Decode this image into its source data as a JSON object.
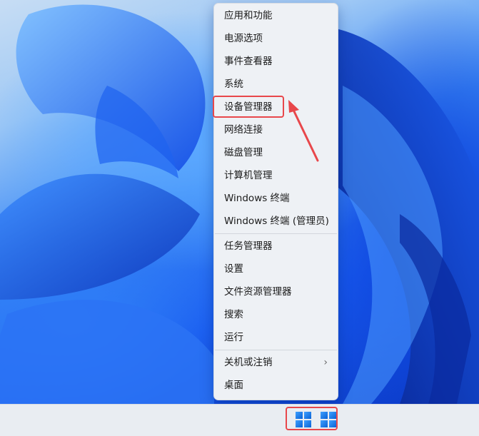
{
  "context_menu": {
    "items": [
      {
        "label": "应用和功能"
      },
      {
        "label": "电源选项"
      },
      {
        "label": "事件查看器"
      },
      {
        "label": "系统"
      },
      {
        "label": "设备管理器"
      },
      {
        "label": "网络连接"
      },
      {
        "label": "磁盘管理"
      },
      {
        "label": "计算机管理"
      },
      {
        "label": "Windows 终端"
      },
      {
        "label": "Windows 终端 (管理员)"
      },
      {
        "label": "任务管理器"
      },
      {
        "label": "设置"
      },
      {
        "label": "文件资源管理器"
      },
      {
        "label": "搜索"
      },
      {
        "label": "运行"
      },
      {
        "label": "关机或注销",
        "submenu": true
      },
      {
        "label": "桌面"
      }
    ],
    "highlighted_item": "设备管理器"
  },
  "annotation": {
    "color": "#e8474b"
  },
  "taskbar": {
    "start_icon": "windows-logo-icon"
  },
  "colors": {
    "wallpaper": "#1a5df0",
    "menu_bg": "#eef1f5",
    "taskbar_bg": "#e9edf2"
  }
}
